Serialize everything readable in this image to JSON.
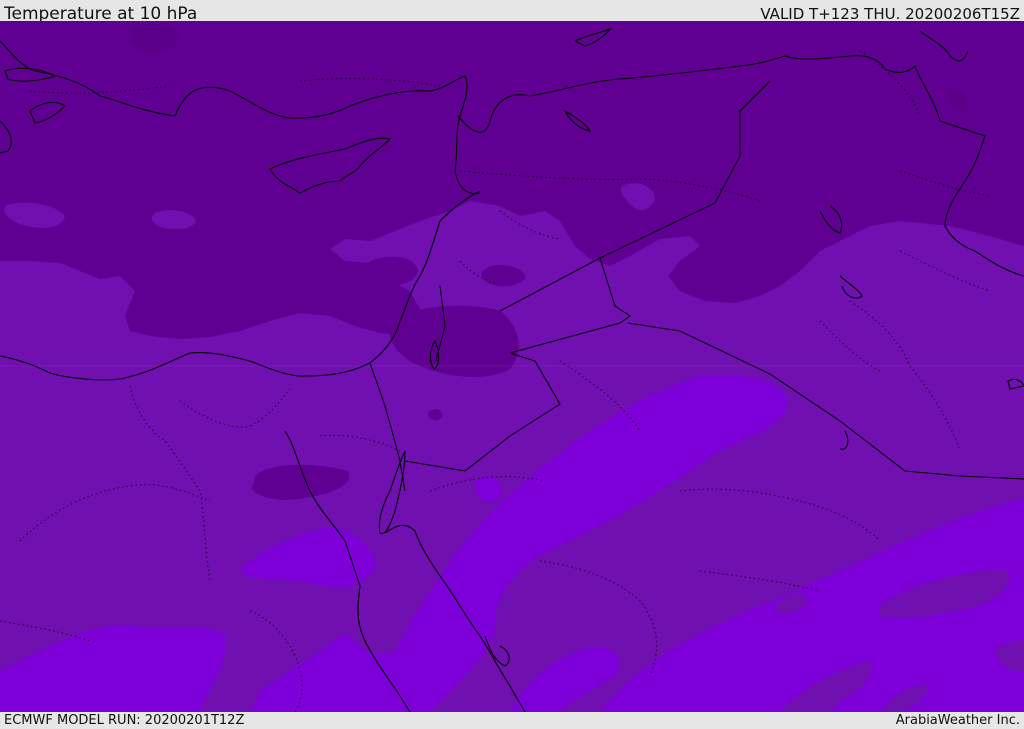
{
  "header": {
    "title": "Temperature at 10 hPa",
    "valid_time": "VALID T+123 THU. 20200206T15Z"
  },
  "footer": {
    "model_run": "ECMWF MODEL RUN: 20200201T12Z",
    "credit": "ArabiaWeather Inc."
  },
  "colors": {
    "band_coldest": "#5f0092",
    "band_mid": "#7010b0",
    "band_warm": "#7d00d8",
    "coastline": "#000000",
    "border": "#000000",
    "frame": "#e6e6e6"
  }
}
